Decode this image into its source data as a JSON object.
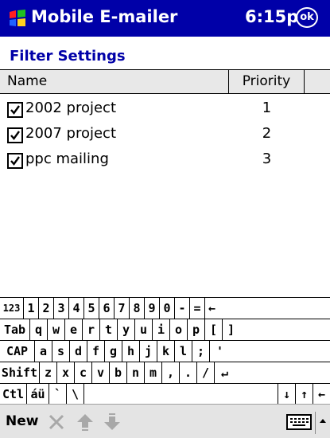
{
  "titlebar": {
    "app_title": "Mobile E-mailer",
    "time": "6:15p",
    "ok_label": "ok",
    "start_icon": "windows-flag-icon"
  },
  "page_title": "Filter Settings",
  "list": {
    "columns": {
      "name": "Name",
      "priority": "Priority"
    },
    "rows": [
      {
        "name": "2002 project",
        "priority": "1",
        "checked": true
      },
      {
        "name": "2007 project",
        "priority": "2",
        "checked": true
      },
      {
        "name": "ppc mailing",
        "priority": "3",
        "checked": true
      }
    ]
  },
  "keyboard": {
    "row1": [
      "123",
      "1",
      "2",
      "3",
      "4",
      "5",
      "6",
      "7",
      "8",
      "9",
      "0",
      "-",
      "=",
      "←"
    ],
    "row2": [
      "Tab",
      "q",
      "w",
      "e",
      "r",
      "t",
      "y",
      "u",
      "i",
      "o",
      "p",
      "[",
      "]"
    ],
    "row3": [
      "CAP",
      "a",
      "s",
      "d",
      "f",
      "g",
      "h",
      "j",
      "k",
      "l",
      ";",
      "'"
    ],
    "row4": [
      "Shift",
      "z",
      "x",
      "c",
      "v",
      "b",
      "n",
      "m",
      ",",
      ".",
      "/",
      "↵"
    ],
    "row5": [
      "Ctl",
      "áü",
      "`",
      "\\",
      "",
      "↓",
      "↑",
      "←",
      "→"
    ]
  },
  "bottombar": {
    "new_label": "New",
    "icons": [
      "delete-icon",
      "move-up-icon",
      "move-down-icon",
      "keyboard-icon",
      "sip-up-arrow-icon"
    ]
  },
  "colors": {
    "titlebar": "#0000a8",
    "title_text": "#0000a8",
    "header_bg": "#e8e8e8",
    "toolbar_bg": "#e4e4e4"
  }
}
